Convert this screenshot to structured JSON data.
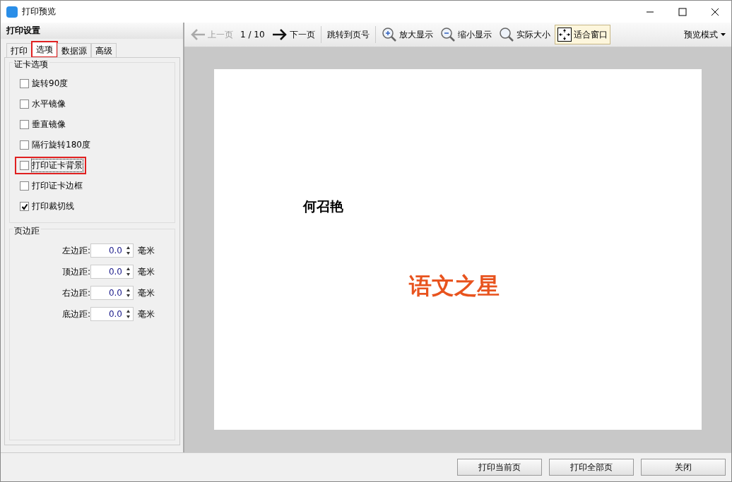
{
  "window": {
    "title": "打印预览"
  },
  "sidebar": {
    "title": "打印设置",
    "tabs": [
      {
        "label": "打印",
        "selected": false,
        "highlighted": false
      },
      {
        "label": "选项",
        "selected": true,
        "highlighted": true
      },
      {
        "label": "数据源",
        "selected": false,
        "highlighted": false
      },
      {
        "label": "高级",
        "selected": false,
        "highlighted": false
      }
    ],
    "card_options": {
      "title": "证卡选项",
      "items": [
        {
          "label": "旋转90度",
          "checked": false,
          "highlighted": false
        },
        {
          "label": "水平镜像",
          "checked": false,
          "highlighted": false
        },
        {
          "label": "垂直镜像",
          "checked": false,
          "highlighted": false
        },
        {
          "label": "隔行旋转180度",
          "checked": false,
          "highlighted": false
        },
        {
          "label": "打印证卡背景",
          "checked": false,
          "highlighted": true
        },
        {
          "label": "打印证卡边框",
          "checked": false,
          "highlighted": false
        },
        {
          "label": "打印裁切线",
          "checked": true,
          "highlighted": false
        }
      ]
    },
    "margins": {
      "title": "页边距",
      "rows": [
        {
          "label": "左边距:",
          "value": "0.0",
          "unit": "毫米"
        },
        {
          "label": "顶边距:",
          "value": "0.0",
          "unit": "毫米"
        },
        {
          "label": "右边距:",
          "value": "0.0",
          "unit": "毫米"
        },
        {
          "label": "底边距:",
          "value": "0.0",
          "unit": "毫米"
        }
      ]
    }
  },
  "toolbar": {
    "items": [
      {
        "kind": "prev",
        "label": "上一页",
        "disabled": true
      },
      {
        "kind": "counter",
        "label": "1 / 10"
      },
      {
        "kind": "next",
        "label": "下一页",
        "disabled": false
      },
      {
        "kind": "separator"
      },
      {
        "kind": "text",
        "label": "跳转到页号"
      },
      {
        "kind": "separator"
      },
      {
        "kind": "zoomin",
        "label": "放大显示",
        "selected": false
      },
      {
        "kind": "zoomout",
        "label": "缩小显示",
        "selected": false
      },
      {
        "kind": "actual",
        "label": "实际大小",
        "selected": false
      },
      {
        "kind": "fit",
        "label": "适合窗口",
        "selected": true
      }
    ],
    "mode_menu": "预览模式"
  },
  "page": {
    "name": "何召艳",
    "award": "语文之星"
  },
  "buttons": [
    "打印当前页",
    "打印全部页",
    "关闭"
  ]
}
